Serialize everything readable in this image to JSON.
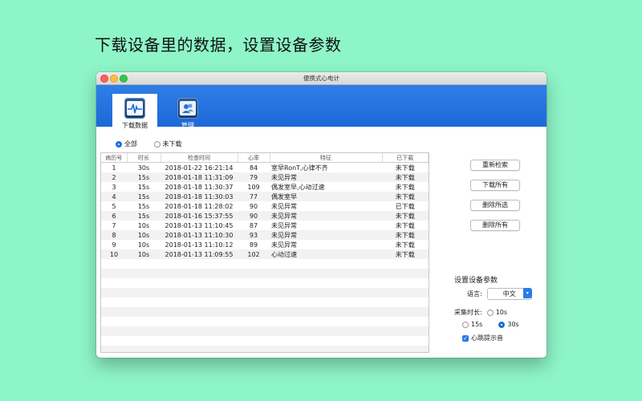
{
  "headline": "下载设备里的数据，设置设备参数",
  "window": {
    "title": "便携式心电计"
  },
  "toolbar": {
    "tabs": [
      {
        "label": "下载数据",
        "icon": "ecg-monitor-icon",
        "active": true
      },
      {
        "label": "管理",
        "icon": "users-icon",
        "active": false
      }
    ]
  },
  "filter": {
    "all_label": "全部",
    "not_downloaded_label": "未下载",
    "selected": "全部"
  },
  "table": {
    "headers": [
      "病历号",
      "时长",
      "检查时间",
      "心率",
      "特征",
      "已下载"
    ],
    "rows": [
      [
        "1",
        "30s",
        "2018-01-22 16:21:14",
        "84",
        "室早RonT,心律不齐",
        "未下载"
      ],
      [
        "2",
        "15s",
        "2018-01-18 11:31:09",
        "79",
        "未见异常",
        "未下载"
      ],
      [
        "3",
        "15s",
        "2018-01-18 11:30:37",
        "109",
        "偶发室早,心动过速",
        "未下载"
      ],
      [
        "4",
        "15s",
        "2018-01-18 11:30:03",
        "77",
        "偶发室早",
        "未下载"
      ],
      [
        "5",
        "15s",
        "2018-01-18 11:28:02",
        "90",
        "未见异常",
        "已下载"
      ],
      [
        "6",
        "15s",
        "2018-01-16 15:37:55",
        "90",
        "未见异常",
        "未下载"
      ],
      [
        "7",
        "10s",
        "2018-01-13 11:10:45",
        "87",
        "未见异常",
        "未下载"
      ],
      [
        "8",
        "10s",
        "2018-01-13 11:10:30",
        "93",
        "未见异常",
        "未下载"
      ],
      [
        "9",
        "10s",
        "2018-01-13 11:10:12",
        "89",
        "未见异常",
        "未下载"
      ],
      [
        "10",
        "10s",
        "2018-01-13 11:09:55",
        "102",
        "心动过速",
        "未下载"
      ]
    ]
  },
  "buttons": {
    "refresh": "重新检索",
    "download_all": "下载所有",
    "delete_selected": "删除所选",
    "delete_all": "删除所有"
  },
  "settings": {
    "title": "设置设备参数",
    "language_label": "语言:",
    "language_value": "中文",
    "duration_label": "采集时长:",
    "durations": [
      "10s",
      "15s",
      "30s"
    ],
    "duration_selected": "30s",
    "beep_label": "心跳提示音",
    "beep_checked": true
  },
  "colors": {
    "background": "#8ef5c8",
    "toolbar": "#2474e0",
    "accent": "#2a7be8"
  }
}
